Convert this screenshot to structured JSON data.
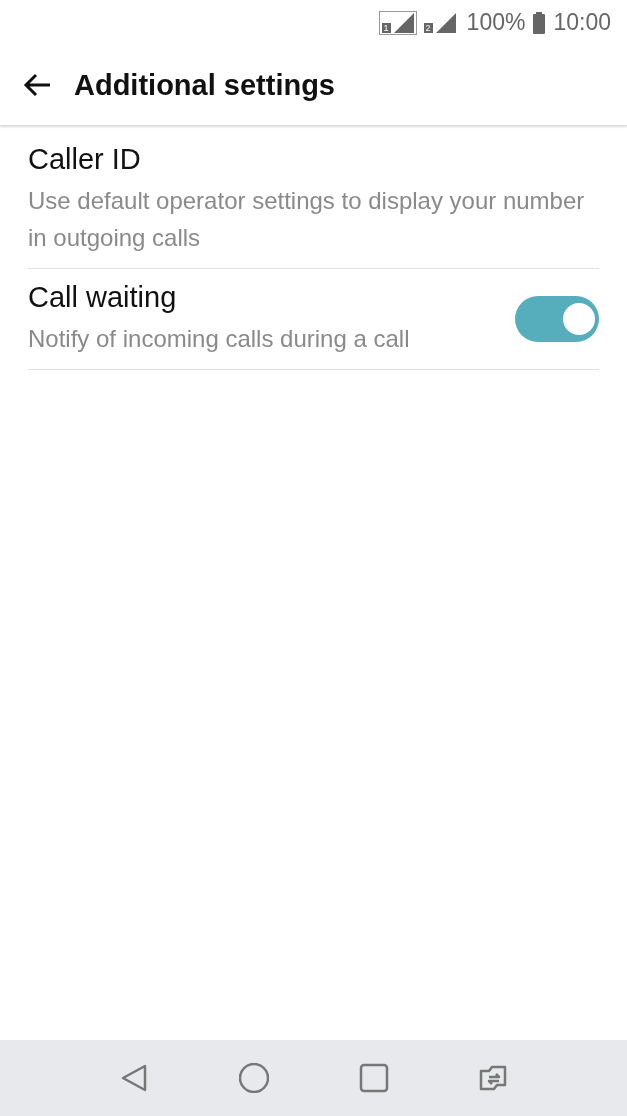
{
  "status_bar": {
    "sims": [
      {
        "label": "1",
        "selected": true
      },
      {
        "label": "2",
        "selected": false
      }
    ],
    "battery": "100%",
    "time": "10:00"
  },
  "header": {
    "title": "Additional settings"
  },
  "settings": [
    {
      "kind": "text",
      "title": "Caller ID",
      "summary": "Use default operator settings to display your number in outgoing calls"
    },
    {
      "kind": "switch",
      "title": "Call waiting",
      "summary": "Notify of incoming calls during a call",
      "on": true
    }
  ]
}
